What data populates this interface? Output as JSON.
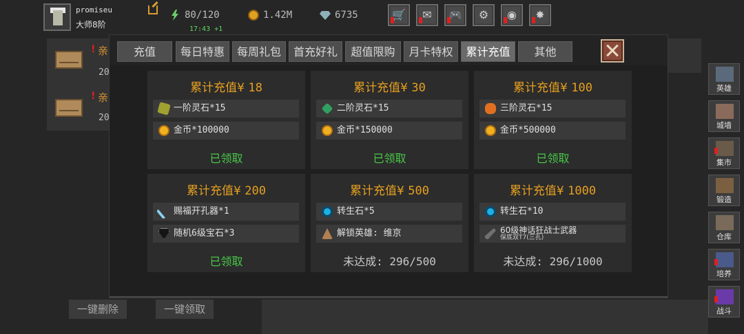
{
  "player": {
    "name": "promiseu",
    "rank": "大师8阶"
  },
  "stats": {
    "stamina": "80/120",
    "stamina_timer": "17:43 +1",
    "gold": "1.42M",
    "gems": "6735"
  },
  "top_buttons": [
    {
      "icon": "shop-cart-icon",
      "glyph": "🛒",
      "alert": true
    },
    {
      "icon": "mail-icon",
      "glyph": "✉",
      "alert": true
    },
    {
      "icon": "gamepad-icon",
      "glyph": "🎮",
      "alert": true
    },
    {
      "icon": "gear-icon",
      "glyph": "⚙",
      "alert": false
    },
    {
      "icon": "wheel-icon",
      "glyph": "◉",
      "alert": true
    },
    {
      "icon": "fireworks-icon",
      "glyph": "✸",
      "alert": true
    }
  ],
  "mail": {
    "items": [
      {
        "title": "亲",
        "date": "20"
      },
      {
        "title": "亲",
        "date": "20"
      }
    ]
  },
  "bottom_buttons": {
    "delete_all": "一键删除",
    "claim_all": "一键领取"
  },
  "sidebar": [
    {
      "label": "英雄",
      "icon": "hero-helmet-icon",
      "alert": false
    },
    {
      "label": "城墙",
      "icon": "castle-wall-icon",
      "alert": false
    },
    {
      "label": "集市",
      "icon": "market-icon",
      "alert": true
    },
    {
      "label": "锻造",
      "icon": "anvil-icon",
      "alert": false
    },
    {
      "label": "仓库",
      "icon": "warehouse-icon",
      "alert": false
    },
    {
      "label": "培养",
      "icon": "cultivate-icon",
      "alert": true
    },
    {
      "label": "战斗",
      "icon": "battle-portal-icon",
      "alert": true
    }
  ],
  "tabs": [
    {
      "label": "充值",
      "active": false,
      "alert": false
    },
    {
      "label": "每日特惠",
      "active": false,
      "alert": false
    },
    {
      "label": "每周礼包",
      "active": false,
      "alert": false
    },
    {
      "label": "首充好礼",
      "active": false,
      "alert": true
    },
    {
      "label": "超值限购",
      "active": false,
      "alert": false
    },
    {
      "label": "月卡特权",
      "active": false,
      "alert": false
    },
    {
      "label": "累计充值",
      "active": true,
      "alert": false
    },
    {
      "label": "其他",
      "active": false,
      "alert": false
    }
  ],
  "cards": [
    {
      "title_prefix": "累计充值¥",
      "amount": "18",
      "rewards": [
        {
          "icon": "stone1",
          "text": "一阶灵石*15"
        },
        {
          "icon": "coin",
          "text": "金币*100000"
        }
      ],
      "status_type": "claimed",
      "status": "已领取"
    },
    {
      "title_prefix": "累计充值¥",
      "amount": "30",
      "rewards": [
        {
          "icon": "stone2",
          "text": "二阶灵石*15"
        },
        {
          "icon": "coin",
          "text": "金币*150000"
        }
      ],
      "status_type": "claimed",
      "status": "已领取"
    },
    {
      "title_prefix": "累计充值¥",
      "amount": "100",
      "rewards": [
        {
          "icon": "stone3",
          "text": "三阶灵石*15"
        },
        {
          "icon": "coin",
          "text": "金币*500000"
        }
      ],
      "status_type": "claimed",
      "status": "已领取"
    },
    {
      "title_prefix": "累计充值¥",
      "amount": "200",
      "rewards": [
        {
          "icon": "drill",
          "text": "赐福开孔器*1"
        },
        {
          "icon": "gem",
          "text": "随机6级宝石*3"
        }
      ],
      "status_type": "claimed",
      "status": "已领取"
    },
    {
      "title_prefix": "累计充值¥",
      "amount": "500",
      "rewards": [
        {
          "icon": "rebirth",
          "text": "转生石*5"
        },
        {
          "icon": "hero",
          "text": "解锁英雄: 维京"
        }
      ],
      "status_type": "pending",
      "status": "未达成: 296/500"
    },
    {
      "title_prefix": "累计充值¥",
      "amount": "1000",
      "rewards": [
        {
          "icon": "rebirth",
          "text": "转生石*10"
        },
        {
          "icon": "weapon",
          "text": "60级神话狂战士武器",
          "subtext": "保底双T7(三孔)"
        }
      ],
      "status_type": "pending",
      "status": "未达成: 296/1000"
    }
  ]
}
